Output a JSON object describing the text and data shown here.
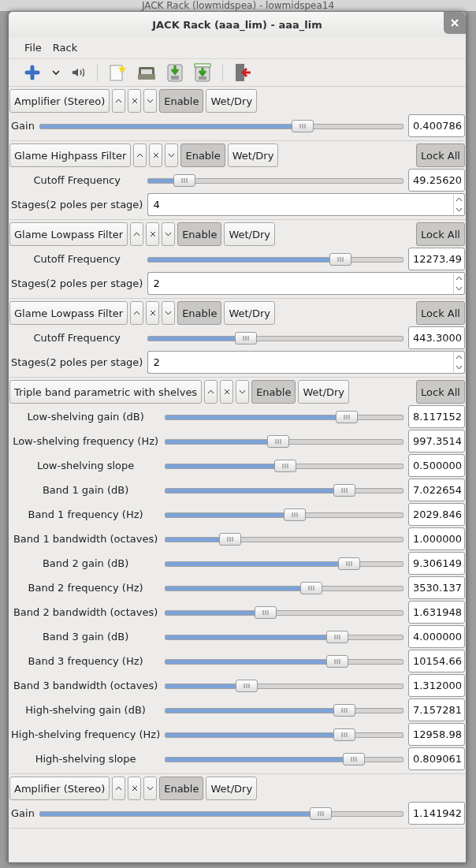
{
  "background_window": {
    "title": "JACK Rack (lowmidspea) - lowmidspea14"
  },
  "window": {
    "title": "JACK Rack (aaa_lim) - aaa_lim"
  },
  "menu": [
    "File",
    "Rack"
  ],
  "plugins": [
    {
      "name": "Amplifier (Stereo)",
      "enable": {
        "label": "Enable",
        "selected": true
      },
      "wet_dry": {
        "label": "Wet/Dry",
        "selected": false
      },
      "controls": [
        {
          "kind": "slider",
          "label": "Gain",
          "level": 0.72,
          "value": "0.400786"
        }
      ]
    },
    {
      "name": "Glame Highpass Filter",
      "enable": {
        "label": "Enable",
        "selected": true
      },
      "wet_dry": {
        "label": "Wet/Dry",
        "selected": false
      },
      "lock_all": {
        "label": "Lock All",
        "selected": true
      },
      "controls": [
        {
          "kind": "slider",
          "label": "Cutoff Frequency",
          "level": 0.14,
          "value": "49.25620"
        },
        {
          "kind": "spin",
          "label": "Stages(2 poles per stage)",
          "value": "4"
        }
      ]
    },
    {
      "name": "Glame Lowpass Filter",
      "enable": {
        "label": "Enable",
        "selected": true
      },
      "wet_dry": {
        "label": "Wet/Dry",
        "selected": false
      },
      "lock_all": {
        "label": "Lock All",
        "selected": true
      },
      "controls": [
        {
          "kind": "slider",
          "label": "Cutoff Frequency",
          "level": 0.75,
          "value": "12273.49"
        },
        {
          "kind": "spin",
          "label": "Stages(2 poles per stage)",
          "value": "2"
        }
      ]
    },
    {
      "name": "Glame Lowpass Filter",
      "enable": {
        "label": "Enable",
        "selected": true
      },
      "wet_dry": {
        "label": "Wet/Dry",
        "selected": false
      },
      "lock_all": {
        "label": "Lock All",
        "selected": true
      },
      "controls": [
        {
          "kind": "slider",
          "label": "Cutoff Frequency",
          "level": 0.38,
          "value": "443.3000"
        },
        {
          "kind": "spin",
          "label": "Stages(2 poles per stage)",
          "value": "2"
        }
      ]
    },
    {
      "name": "Triple band parametric with shelves",
      "enable": {
        "label": "Enable",
        "selected": true
      },
      "wet_dry": {
        "label": "Wet/Dry",
        "selected": false
      },
      "lock_all": {
        "label": "Lock All",
        "selected": true
      },
      "controls": [
        {
          "kind": "slider",
          "label": "Low-shelving gain (dB)",
          "level": 0.76,
          "value": "8.117152"
        },
        {
          "kind": "slider",
          "label": "Low-shelving frequency (Hz)",
          "level": 0.47,
          "value": "997.3514"
        },
        {
          "kind": "slider",
          "label": "Low-shelving slope",
          "level": 0.5,
          "value": "0.500000"
        },
        {
          "kind": "slider",
          "label": "Band 1 gain (dB)",
          "level": 0.75,
          "value": "7.022654"
        },
        {
          "kind": "slider",
          "label": "Band 1 frequency (Hz)",
          "level": 0.54,
          "value": "2029.846"
        },
        {
          "kind": "slider",
          "label": "Band 1 bandwidth (octaves)",
          "level": 0.27,
          "value": "1.000000"
        },
        {
          "kind": "slider",
          "label": "Band 2 gain (dB)",
          "level": 0.77,
          "value": "9.306149"
        },
        {
          "kind": "slider",
          "label": "Band 2 frequency (Hz)",
          "level": 0.61,
          "value": "3530.137"
        },
        {
          "kind": "slider",
          "label": "Band 2 bandwidth (octaves)",
          "level": 0.42,
          "value": "1.631948"
        },
        {
          "kind": "slider",
          "label": "Band 3 gain (dB)",
          "level": 0.72,
          "value": "4.000000"
        },
        {
          "kind": "slider",
          "label": "Band 3 frequency (Hz)",
          "level": 0.72,
          "value": "10154.66"
        },
        {
          "kind": "slider",
          "label": "Band 3 bandwidth (octaves)",
          "level": 0.34,
          "value": "1.312000"
        },
        {
          "kind": "slider",
          "label": "High-shelving gain (dB)",
          "level": 0.75,
          "value": "7.157281"
        },
        {
          "kind": "slider",
          "label": "High-shelving frequency (Hz)",
          "level": 0.75,
          "value": "12958.98"
        },
        {
          "kind": "slider",
          "label": "High-shelving slope",
          "level": 0.79,
          "value": "0.809061"
        }
      ]
    },
    {
      "name": "Amplifier (Stereo)",
      "enable": {
        "label": "Enable",
        "selected": true
      },
      "wet_dry": {
        "label": "Wet/Dry",
        "selected": false
      },
      "controls": [
        {
          "kind": "slider",
          "label": "Gain",
          "level": 0.77,
          "value": "1.141942"
        }
      ]
    }
  ]
}
